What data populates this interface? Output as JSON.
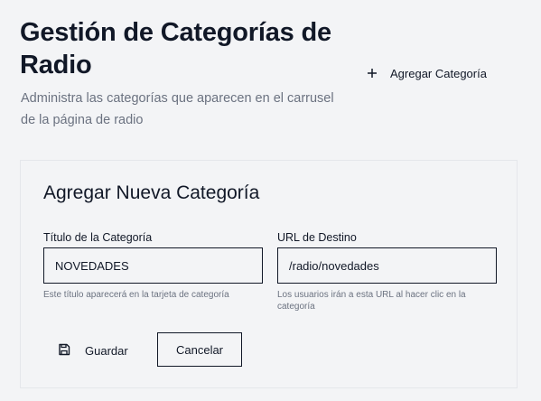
{
  "header": {
    "title": "Gestión de Categorías de Radio",
    "description": "Administra las categorías que aparecen en el carrusel de la página de radio",
    "add_button_label": "Agregar Categoría"
  },
  "form": {
    "title": "Agregar Nueva Categoría",
    "title_field": {
      "label": "Título de la Categoría",
      "value": "NOVEDADES",
      "help": "Este título aparecerá en la tarjeta de categoría"
    },
    "url_field": {
      "label": "URL de Destino",
      "value": "/radio/novedades",
      "help": "Los usuarios irán a esta URL al hacer clic en la categoría"
    },
    "save_label": "Guardar",
    "cancel_label": "Cancelar"
  },
  "icons": {
    "add": "plus-icon",
    "save": "save-icon"
  }
}
